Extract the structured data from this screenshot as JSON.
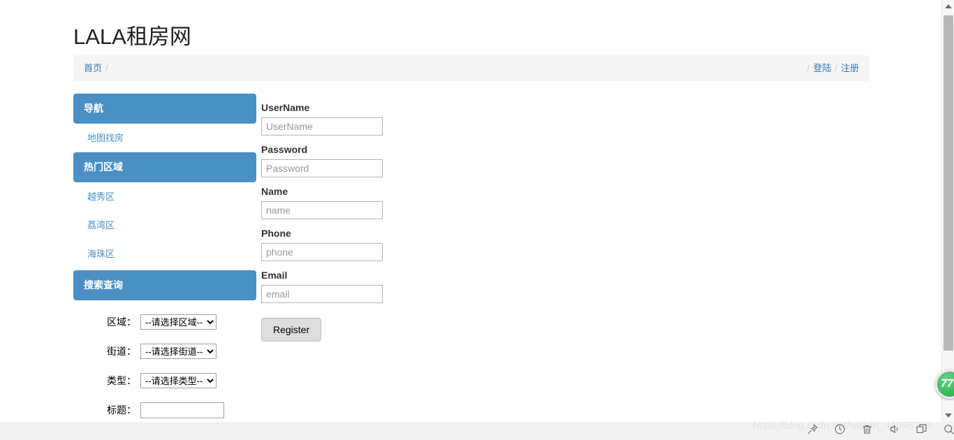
{
  "site": {
    "title": "LALA租房网"
  },
  "breadcrumb": {
    "home_label": "首页",
    "separator": "/",
    "login_label": "登陆",
    "register_label": "注册"
  },
  "sidebar": {
    "sections": [
      {
        "header": "导航",
        "links": [
          "地图找房"
        ]
      },
      {
        "header": "热门区域",
        "links": [
          "越秀区",
          "荔湾区",
          "海珠区"
        ]
      },
      {
        "header": "搜索查询",
        "links": []
      }
    ],
    "nav_header": "导航",
    "map_link": "地图找房",
    "hot_header": "热门区域",
    "district_1": "越秀区",
    "district_2": "荔湾区",
    "district_3": "海珠区",
    "search_header": "搜索查询"
  },
  "search_form": {
    "area_label": "区域：",
    "area_value": "--请选择区域--",
    "street_label": "街道：",
    "street_value": "--请选择街道--",
    "type_label": "类型：",
    "type_value": "--请选择类型--",
    "title_label": "标题：",
    "title_value": ""
  },
  "register_form": {
    "fields": [
      {
        "label": "UserName",
        "placeholder": "UserName",
        "value": ""
      },
      {
        "label": "Password",
        "placeholder": "Password",
        "value": ""
      },
      {
        "label": "Name",
        "placeholder": "name",
        "value": ""
      },
      {
        "label": "Phone",
        "placeholder": "phone",
        "value": ""
      },
      {
        "label": "Email",
        "placeholder": "email",
        "value": ""
      }
    ],
    "username_label": "UserName",
    "username_placeholder": "UserName",
    "password_label": "Password",
    "password_placeholder": "Password",
    "name_label": "Name",
    "name_placeholder": "name",
    "phone_label": "Phone",
    "phone_placeholder": "phone",
    "email_label": "Email",
    "email_placeholder": "email",
    "submit_label": "Register"
  },
  "overlay": {
    "watermark": "https://blog.csdn.net/weixin_44595789",
    "badge_count": "77"
  },
  "tray": {
    "icons": [
      "pin-icon",
      "compass-icon",
      "trash-icon",
      "speaker-icon",
      "window-icon",
      "search-icon"
    ]
  },
  "colors": {
    "accent_blue": "#4a90c4",
    "link_blue": "#337ab7",
    "breadcrumb_bg": "#f5f5f5",
    "badge_green": "#3bbd5c"
  }
}
